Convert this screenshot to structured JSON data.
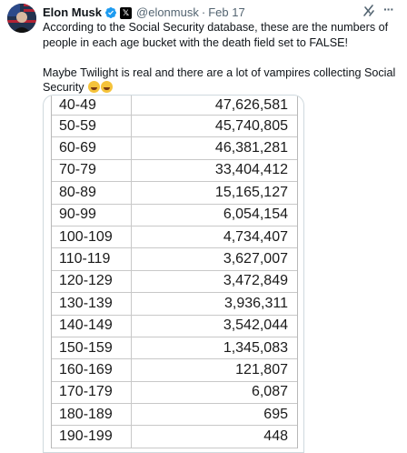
{
  "author": {
    "name": "Elon Musk",
    "handle": "@elonmusk",
    "separator": "·",
    "date": "Feb 17"
  },
  "icons": {
    "verified": "verified-badge-icon",
    "affiliate": "x-affiliate-icon",
    "grok": "grok-icon",
    "more": "more-options-icon",
    "emoji": "rolling-laughing-emoji"
  },
  "tweet": {
    "line1": "According to the Social Security database, these are the numbers of people in each age bucket with the death field set to FALSE!",
    "line2": "Maybe Twilight is real and there are a lot of vampires collecting Social Security",
    "more_label": "···",
    "x_label": "𝕏"
  },
  "colors": {
    "verified_blue": "#1d9bf0",
    "secondary_text": "#536471",
    "border": "#cfd9de"
  },
  "table": {
    "rows": [
      {
        "age": "40-49",
        "count": "47,626,581"
      },
      {
        "age": "50-59",
        "count": "45,740,805"
      },
      {
        "age": "60-69",
        "count": "46,381,281"
      },
      {
        "age": "70-79",
        "count": "33,404,412"
      },
      {
        "age": "80-89",
        "count": "15,165,127"
      },
      {
        "age": "90-99",
        "count": "6,054,154"
      },
      {
        "age": "100-109",
        "count": "4,734,407"
      },
      {
        "age": "110-119",
        "count": "3,627,007"
      },
      {
        "age": "120-129",
        "count": "3,472,849"
      },
      {
        "age": "130-139",
        "count": "3,936,311"
      },
      {
        "age": "140-149",
        "count": "3,542,044"
      },
      {
        "age": "150-159",
        "count": "1,345,083"
      },
      {
        "age": "160-169",
        "count": "121,807"
      },
      {
        "age": "170-179",
        "count": "6,087"
      },
      {
        "age": "180-189",
        "count": "695"
      },
      {
        "age": "190-199",
        "count": "448"
      }
    ]
  }
}
